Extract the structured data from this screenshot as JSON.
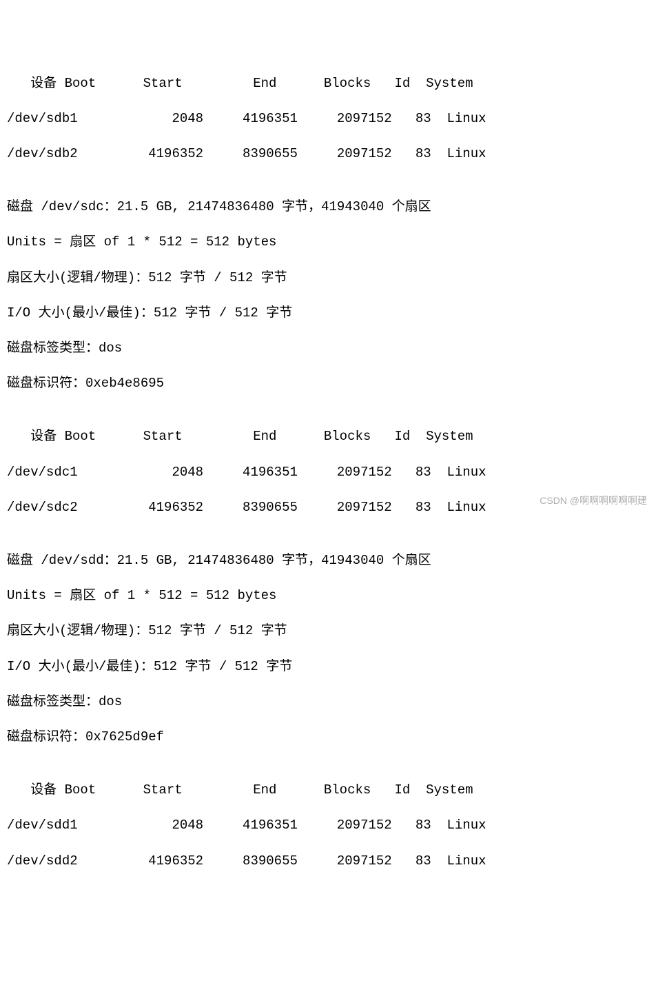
{
  "sections": [
    {
      "header": "   设备 Boot      Start         End      Blocks   Id  System",
      "rows": [
        "/dev/sdb1            2048     4196351     2097152   83  Linux",
        "/dev/sdb2         4196352     8390655     2097152   83  Linux"
      ],
      "info": [
        "",
        "磁盘 /dev/sdc：21.5 GB, 21474836480 字节，41943040 个扇区",
        "Units = 扇区 of 1 * 512 = 512 bytes",
        "扇区大小(逻辑/物理)：512 字节 / 512 字节",
        "I/O 大小(最小/最佳)：512 字节 / 512 字节",
        "磁盘标签类型：dos",
        "磁盘标识符：0xeb4e8695",
        ""
      ]
    },
    {
      "header": "   设备 Boot      Start         End      Blocks   Id  System",
      "rows": [
        "/dev/sdc1            2048     4196351     2097152   83  Linux",
        "/dev/sdc2         4196352     8390655     2097152   83  Linux"
      ],
      "info": [
        "",
        "磁盘 /dev/sdd：21.5 GB, 21474836480 字节，41943040 个扇区",
        "Units = 扇区 of 1 * 512 = 512 bytes",
        "扇区大小(逻辑/物理)：512 字节 / 512 字节",
        "I/O 大小(最小/最佳)：512 字节 / 512 字节",
        "磁盘标签类型：dos",
        "磁盘标识符：0x7625d9ef",
        ""
      ]
    },
    {
      "header": "   设备 Boot      Start         End      Blocks   Id  System",
      "rows": [
        "/dev/sdd1            2048     4196351     2097152   83  Linux",
        "/dev/sdd2         4196352     8390655     2097152   83  Linux"
      ],
      "info": []
    }
  ],
  "columns": [
    "设备",
    "Boot",
    "Start",
    "End",
    "Blocks",
    "Id",
    "System"
  ],
  "chart_data": {
    "type": "table",
    "title": "fdisk partition listing",
    "columns": [
      "Device",
      "Boot",
      "Start",
      "End",
      "Blocks",
      "Id",
      "System"
    ],
    "rows": [
      {
        "Device": "/dev/sdb1",
        "Boot": "",
        "Start": 2048,
        "End": 4196351,
        "Blocks": 2097152,
        "Id": "83",
        "System": "Linux"
      },
      {
        "Device": "/dev/sdb2",
        "Boot": "",
        "Start": 4196352,
        "End": 8390655,
        "Blocks": 2097152,
        "Id": "83",
        "System": "Linux"
      },
      {
        "Device": "/dev/sdc1",
        "Boot": "",
        "Start": 2048,
        "End": 4196351,
        "Blocks": 2097152,
        "Id": "83",
        "System": "Linux"
      },
      {
        "Device": "/dev/sdc2",
        "Boot": "",
        "Start": 4196352,
        "End": 8390655,
        "Blocks": 2097152,
        "Id": "83",
        "System": "Linux"
      },
      {
        "Device": "/dev/sdd1",
        "Boot": "",
        "Start": 2048,
        "End": 4196351,
        "Blocks": 2097152,
        "Id": "83",
        "System": "Linux"
      },
      {
        "Device": "/dev/sdd2",
        "Boot": "",
        "Start": 4196352,
        "End": 8390655,
        "Blocks": 2097152,
        "Id": "83",
        "System": "Linux"
      }
    ],
    "disks": [
      {
        "name": "/dev/sdc",
        "size_gb": 21.5,
        "bytes": 21474836480,
        "sectors": 41943040,
        "sector_size_logical": 512,
        "sector_size_physical": 512,
        "io_min": 512,
        "io_opt": 512,
        "label_type": "dos",
        "identifier": "0xeb4e8695"
      },
      {
        "name": "/dev/sdd",
        "size_gb": 21.5,
        "bytes": 21474836480,
        "sectors": 41943040,
        "sector_size_logical": 512,
        "sector_size_physical": 512,
        "io_min": 512,
        "io_opt": 512,
        "label_type": "dos",
        "identifier": "0x7625d9ef"
      }
    ]
  },
  "watermark": "CSDN @啊啊啊啊啊啊建"
}
